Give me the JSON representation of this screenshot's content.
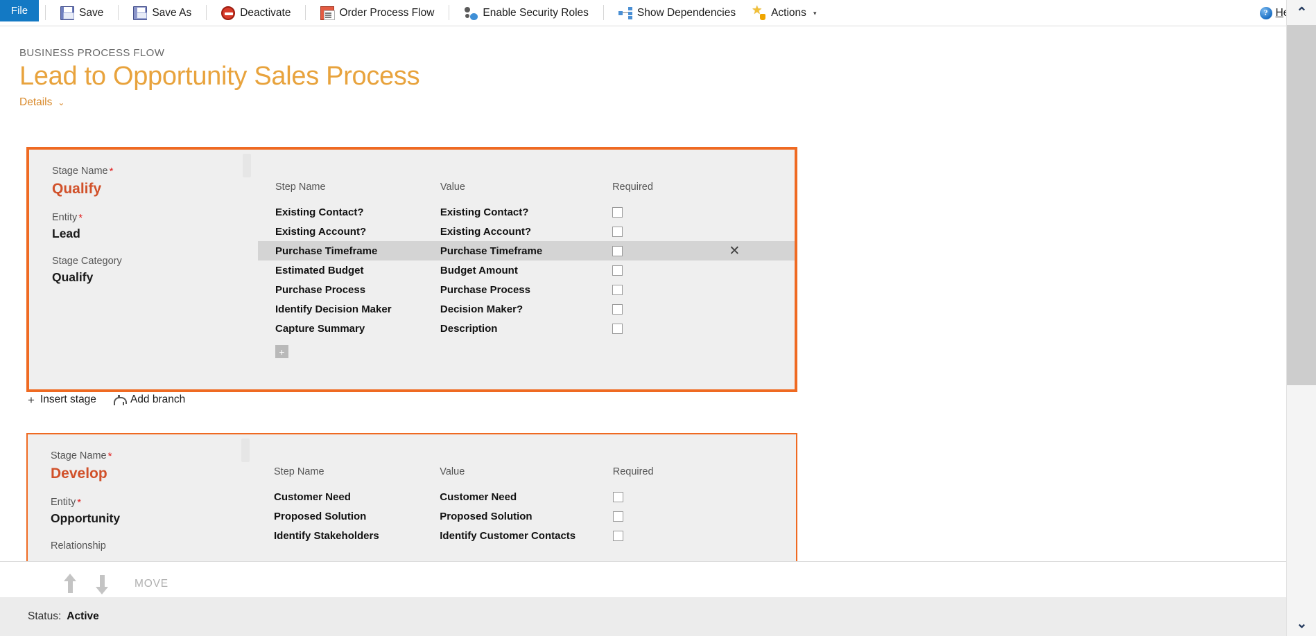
{
  "toolbar": {
    "file_tab": "File",
    "buttons": [
      {
        "label": "Save",
        "icon": "save-icon"
      },
      {
        "label": "Save As",
        "icon": "save-as-icon"
      },
      {
        "label": "Deactivate",
        "icon": "deactivate-icon"
      },
      {
        "label": "Order Process Flow",
        "icon": "order-process-flow-icon"
      },
      {
        "label": "Enable Security Roles",
        "icon": "security-roles-icon"
      },
      {
        "label": "Show Dependencies",
        "icon": "show-dependencies-icon"
      },
      {
        "label": "Actions",
        "icon": "actions-icon",
        "caret": "▾"
      }
    ],
    "help": {
      "label_pre": "H",
      "label_post": "elp",
      "caret": "▾",
      "icon": "help-icon"
    }
  },
  "header": {
    "eyebrow": "BUSINESS PROCESS FLOW",
    "title": "Lead to Opportunity Sales Process",
    "details_label": "Details",
    "details_chevron": "⌄"
  },
  "columns": {
    "step_name": "Step Name",
    "value": "Value",
    "required": "Required"
  },
  "labels": {
    "stage_name": "Stage Name",
    "entity": "Entity",
    "stage_category": "Stage Category",
    "relationship": "Relationship",
    "required_star": "*",
    "add_step": "+",
    "delete_step": "✕"
  },
  "stages": [
    {
      "stage_name": "Qualify",
      "entity": "Lead",
      "stage_category": "Qualify",
      "selected": true,
      "steps": [
        {
          "step_name": "Existing Contact?",
          "value": "Existing Contact?",
          "required": false,
          "active": false
        },
        {
          "step_name": "Existing Account?",
          "value": "Existing Account?",
          "required": false,
          "active": false
        },
        {
          "step_name": "Purchase Timeframe",
          "value": "Purchase Timeframe",
          "required": false,
          "active": true
        },
        {
          "step_name": "Estimated Budget",
          "value": "Budget Amount",
          "required": false,
          "active": false
        },
        {
          "step_name": "Purchase Process",
          "value": "Purchase Process",
          "required": false,
          "active": false
        },
        {
          "step_name": "Identify Decision Maker",
          "value": "Decision Maker?",
          "required": false,
          "active": false
        },
        {
          "step_name": "Capture Summary",
          "value": "Description",
          "required": false,
          "active": false
        }
      ]
    },
    {
      "stage_name": "Develop",
      "entity": "Opportunity",
      "stage_category": "",
      "relationship": "",
      "selected": false,
      "steps": [
        {
          "step_name": "Customer Need",
          "value": "Customer Need",
          "required": false,
          "active": false
        },
        {
          "step_name": "Proposed Solution",
          "value": "Proposed Solution",
          "required": false,
          "active": false
        },
        {
          "step_name": "Identify Stakeholders",
          "value": "Identify Customer Contacts",
          "required": false,
          "active": false
        }
      ]
    }
  ],
  "stage_actions": {
    "insert_stage": "Insert stage",
    "insert_stage_glyph": "+",
    "add_branch": "Add branch"
  },
  "move_bar": {
    "label": "MOVE",
    "up_title": "Move up",
    "down_title": "Move down"
  },
  "status_bar": {
    "key": "Status:",
    "value": "Active"
  },
  "scrollbar": {
    "up_glyph": "⌃",
    "down_glyph": "⌄"
  },
  "colors": {
    "accent_orange": "#ef6a22",
    "title_orange": "#e8a33d",
    "stage_name_red": "#d1512a",
    "file_blue": "#1379c4",
    "card_bg": "#efefef",
    "row_active": "#d4d4d4"
  }
}
